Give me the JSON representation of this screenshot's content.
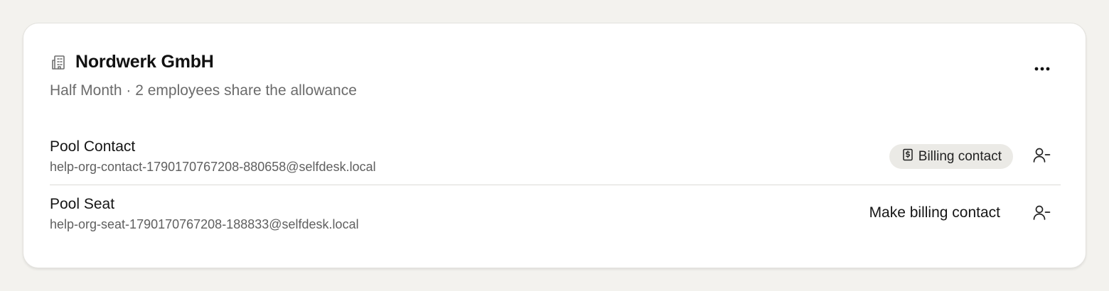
{
  "organization": {
    "name": "Nordwerk GmbH",
    "subtitle": "Half Month · 2 employees share the allowance",
    "icon": "building-icon",
    "more_icon": "more-horizontal-icon"
  },
  "members": [
    {
      "name": "Pool Contact",
      "email": "help-org-contact-1790170767208-880658@selfdesk.local",
      "badge": "Billing contact",
      "badge_icon": "receipt-dollar-icon",
      "action_icon": "user-minus-icon"
    },
    {
      "name": "Pool Seat",
      "email": "help-org-seat-1790170767208-188833@selfdesk.local",
      "action_label": "Make billing contact",
      "action_icon": "user-minus-icon"
    }
  ],
  "colors": {
    "page_background": "#f3f2ee",
    "card_background": "#ffffff",
    "badge_background": "#ebeae6",
    "subtitle_text": "#6b6b6b"
  }
}
